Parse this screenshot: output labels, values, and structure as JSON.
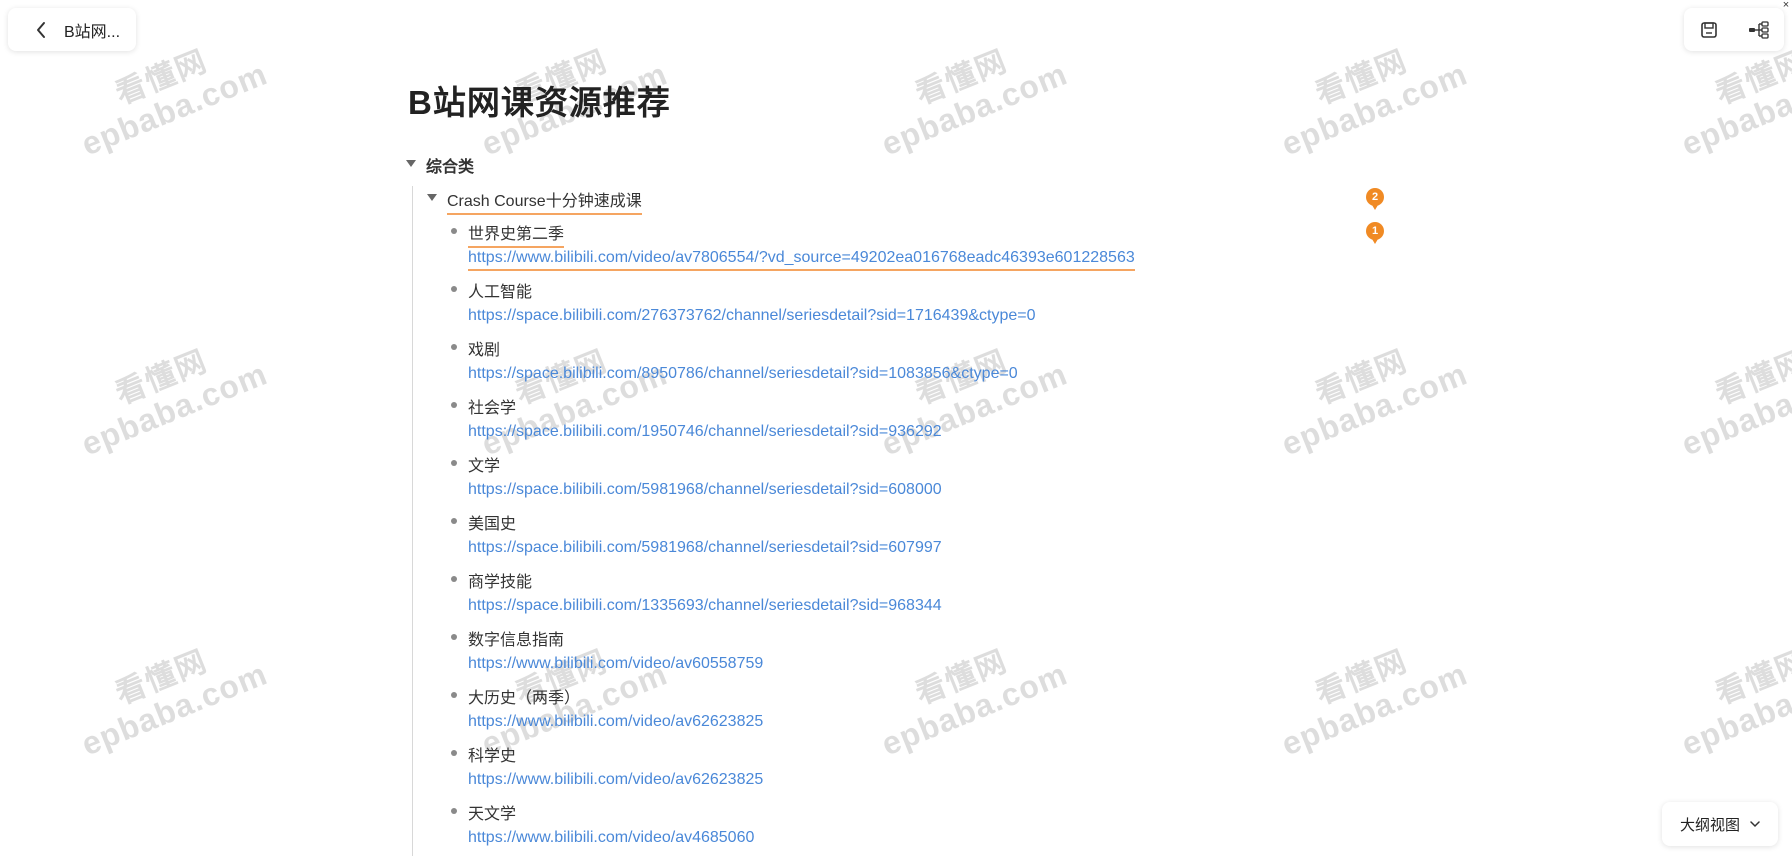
{
  "header": {
    "back_title": "B站网...",
    "tools": [
      "save-icon",
      "mindmap-icon"
    ],
    "close_glyph": "×"
  },
  "watermark": {
    "cn": "看懂网",
    "en": "epbaba.com"
  },
  "document": {
    "title": "B站网课资源推荐",
    "category": "综合类",
    "subcategory": "Crash Course十分钟速成课",
    "items": [
      {
        "name": "世界史第二季",
        "url": "https://www.bilibili.com/video/av7806554/?vd_source=49202ea016768eadc46393e601228563"
      },
      {
        "name": "人工智能",
        "url": "https://space.bilibili.com/276373762/channel/seriesdetail?sid=1716439&ctype=0"
      },
      {
        "name": "戏剧",
        "url": "https://space.bilibili.com/8950786/channel/seriesdetail?sid=1083856&ctype=0"
      },
      {
        "name": "社会学",
        "url": "https://space.bilibili.com/1950746/channel/seriesdetail?sid=936292"
      },
      {
        "name": "文学",
        "url": "https://space.bilibili.com/5981968/channel/seriesdetail?sid=608000"
      },
      {
        "name": "美国史",
        "url": "https://space.bilibili.com/5981968/channel/seriesdetail?sid=607997"
      },
      {
        "name": "商学技能",
        "url": "https://space.bilibili.com/1335693/channel/seriesdetail?sid=968344"
      },
      {
        "name": "数字信息指南",
        "url": "https://www.bilibili.com/video/av60558759"
      },
      {
        "name": "大历史（两季）",
        "url": "https://www.bilibili.com/video/av62623825"
      },
      {
        "name": "科学史",
        "url": "https://www.bilibili.com/video/av62623825"
      },
      {
        "name": "天文学",
        "url": "https://www.bilibili.com/video/av4685060"
      }
    ]
  },
  "comments": {
    "badge_subcategory": "2",
    "badge_first_item": "1",
    "color": "#f08a24"
  },
  "view_selector": {
    "label": "大纲视图"
  },
  "colors": {
    "link": "#4a88d8",
    "highlight_underline": "#f5a561"
  }
}
